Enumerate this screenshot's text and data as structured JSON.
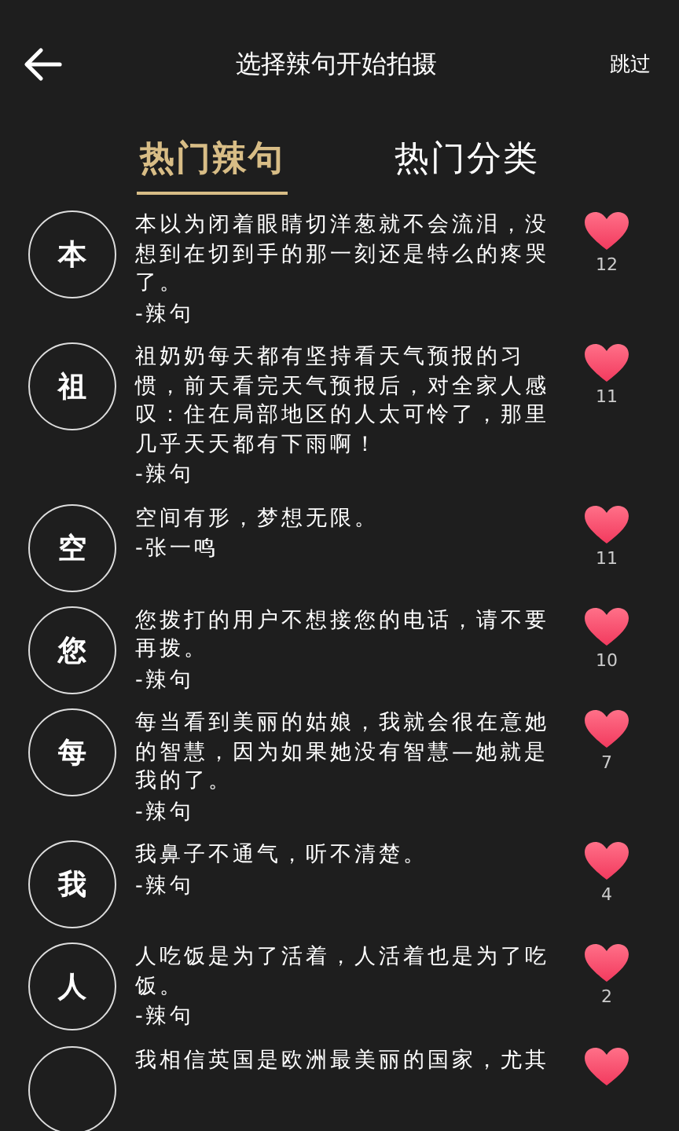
{
  "header": {
    "title": "选择辣句开始拍摄",
    "skip": "跳过"
  },
  "tabs": [
    {
      "label": "热门辣句",
      "selected": true
    },
    {
      "label": "热门分类",
      "selected": false
    }
  ],
  "quotes": [
    {
      "avatar": "本",
      "text": "本以为闭着眼睛切洋葱就不会流泪，没想到在切到手的那一刻还是特么的疼哭了。",
      "source": "-辣句",
      "likes": "12"
    },
    {
      "avatar": "祖",
      "text": "祖奶奶每天都有坚持看天气预报的习惯，前天看完天气预报后，对全家人感叹：住在局部地区的人太可怜了，那里几乎天天都有下雨啊！",
      "source": "-辣句",
      "likes": "11"
    },
    {
      "avatar": "空",
      "text": "空间有形，梦想无限。",
      "source": "-张一鸣",
      "likes": "11"
    },
    {
      "avatar": "您",
      "text": "您拨打的用户不想接您的电话，请不要再拨。",
      "source": "-辣句",
      "likes": "10"
    },
    {
      "avatar": "每",
      "text": "每当看到美丽的姑娘，我就会很在意她的智慧，因为如果她没有智慧—她就是我的了。",
      "source": "-辣句",
      "likes": "7"
    },
    {
      "avatar": "我",
      "text": "我鼻子不通气，听不清楚。",
      "source": "-辣句",
      "likes": "4"
    },
    {
      "avatar": "人",
      "text": "人吃饭是为了活着，人活着也是为了吃饭。",
      "source": "-辣句",
      "likes": "2"
    },
    {
      "text": "我相信英国是欧洲最美丽的国家，尤其"
    }
  ]
}
